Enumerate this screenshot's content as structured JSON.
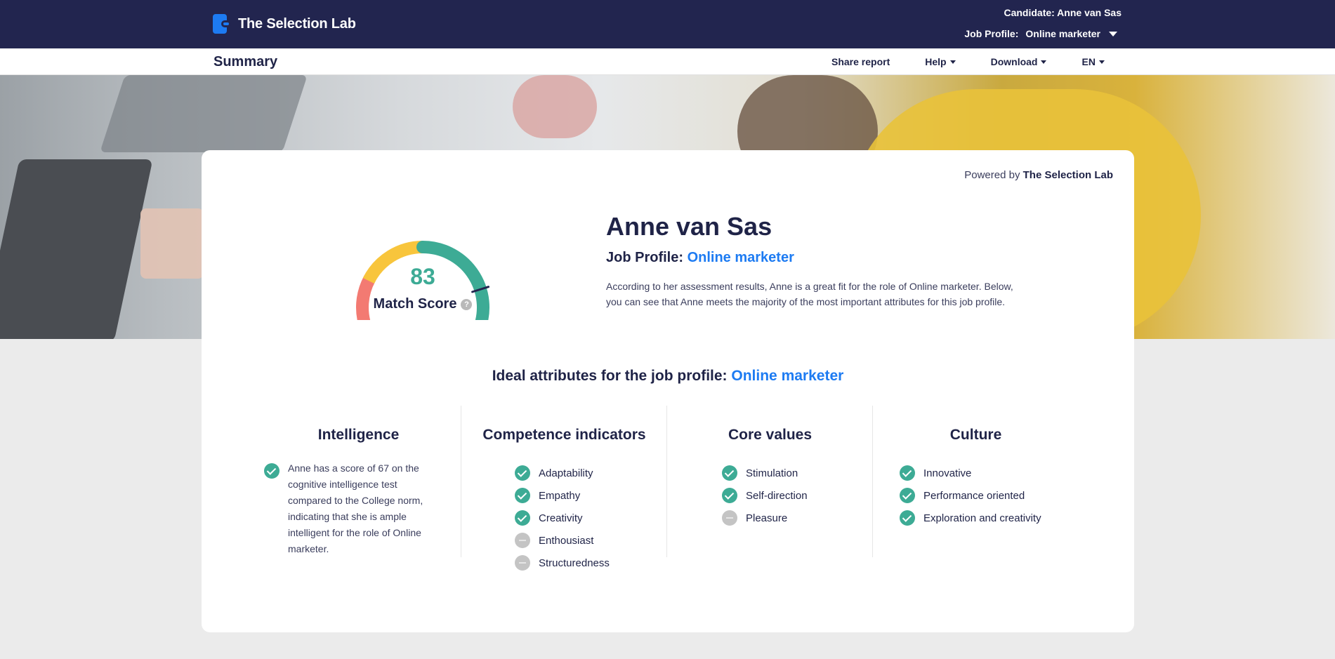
{
  "app": {
    "name": "The Selection Lab"
  },
  "header": {
    "candidate_label": "Candidate: Anne van Sas",
    "job_profile_label": "Job Profile:",
    "job_profile_value": "Online marketer"
  },
  "subbar": {
    "title": "Summary",
    "nav": [
      {
        "label": "Share report"
      },
      {
        "label": "Help"
      },
      {
        "label": "Download"
      },
      {
        "label": "EN"
      }
    ]
  },
  "card": {
    "powered_prefix": "Powered by",
    "powered_brand": "The Selection Lab",
    "gauge": {
      "score": "83",
      "label": "Match Score",
      "help": "?",
      "value": 83,
      "max": 100,
      "colors": {
        "red": "#f37a72",
        "yellow": "#f8c53c",
        "green": "#3dab95",
        "needle": "#22254f"
      }
    },
    "candidate_name": "Anne van Sas",
    "job_profile_label": "Job Profile:",
    "job_profile_value": "Online marketer",
    "description": "According to her assessment results, Anne is a great fit for the role of Online marketer. Below, you can see that Anne meets the majority of the most important attributes for this job profile.",
    "ideal_heading": "Ideal attributes for the job profile:",
    "ideal_profile": "Online marketer",
    "columns": {
      "intelligence": {
        "title": "Intelligence",
        "text": "Anne has a score of 67 on the cognitive intelligence test compared to the College norm, indicating that she is ample intelligent for the role of Online marketer."
      },
      "competence": {
        "title": "Competence indicators",
        "items": [
          {
            "label": "Adaptability",
            "status": "met"
          },
          {
            "label": "Empathy",
            "status": "met"
          },
          {
            "label": "Creativity",
            "status": "met"
          },
          {
            "label": "Enthousiast",
            "status": "neutral"
          },
          {
            "label": "Structuredness",
            "status": "neutral"
          }
        ]
      },
      "core_values": {
        "title": "Core values",
        "items": [
          {
            "label": "Stimulation",
            "status": "met"
          },
          {
            "label": "Self-direction",
            "status": "met"
          },
          {
            "label": "Pleasure",
            "status": "neutral"
          }
        ]
      },
      "culture": {
        "title": "Culture",
        "items": [
          {
            "label": "Innovative",
            "status": "met"
          },
          {
            "label": "Performance oriented",
            "status": "met"
          },
          {
            "label": "Exploration and creativity",
            "status": "met"
          }
        ]
      }
    }
  },
  "colors": {
    "navy": "#22254f",
    "blue": "#1d7bf2",
    "green": "#3dab95",
    "gray": "#c4c4c4"
  }
}
